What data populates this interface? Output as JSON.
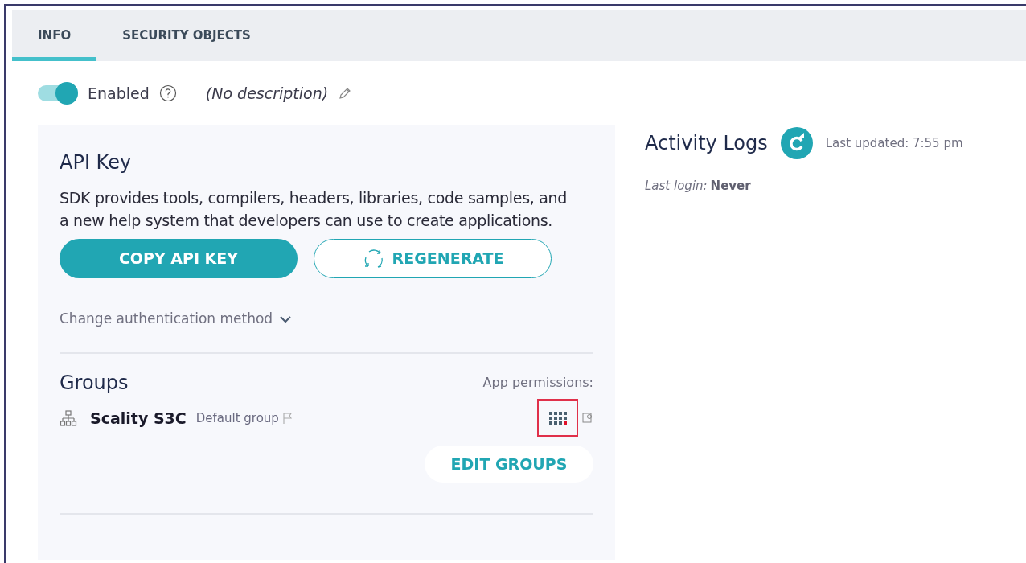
{
  "tabs": [
    {
      "label": "INFO",
      "selected": true
    },
    {
      "label": "SECURITY OBJECTS",
      "selected": false
    }
  ],
  "status": {
    "enabled": true,
    "label": "Enabled",
    "description": "(No description)"
  },
  "api_key": {
    "title": "API Key",
    "text": "SDK provides tools, compilers, headers, libraries, code samples, and a new help system that developers can use to create applications.",
    "copy_button": "COPY API KEY",
    "regenerate_button": "REGENERATE",
    "auth_link": "Change authentication method"
  },
  "groups": {
    "title": "Groups",
    "permissions_label": "App permissions:",
    "items": [
      {
        "name": "Scality S3C",
        "tag": "Default group"
      }
    ],
    "edit_button": "EDIT GROUPS"
  },
  "activity": {
    "title": "Activity Logs",
    "updated": "Last updated: 7:55 pm",
    "login_label": "Last login:",
    "login_value": "Never"
  }
}
